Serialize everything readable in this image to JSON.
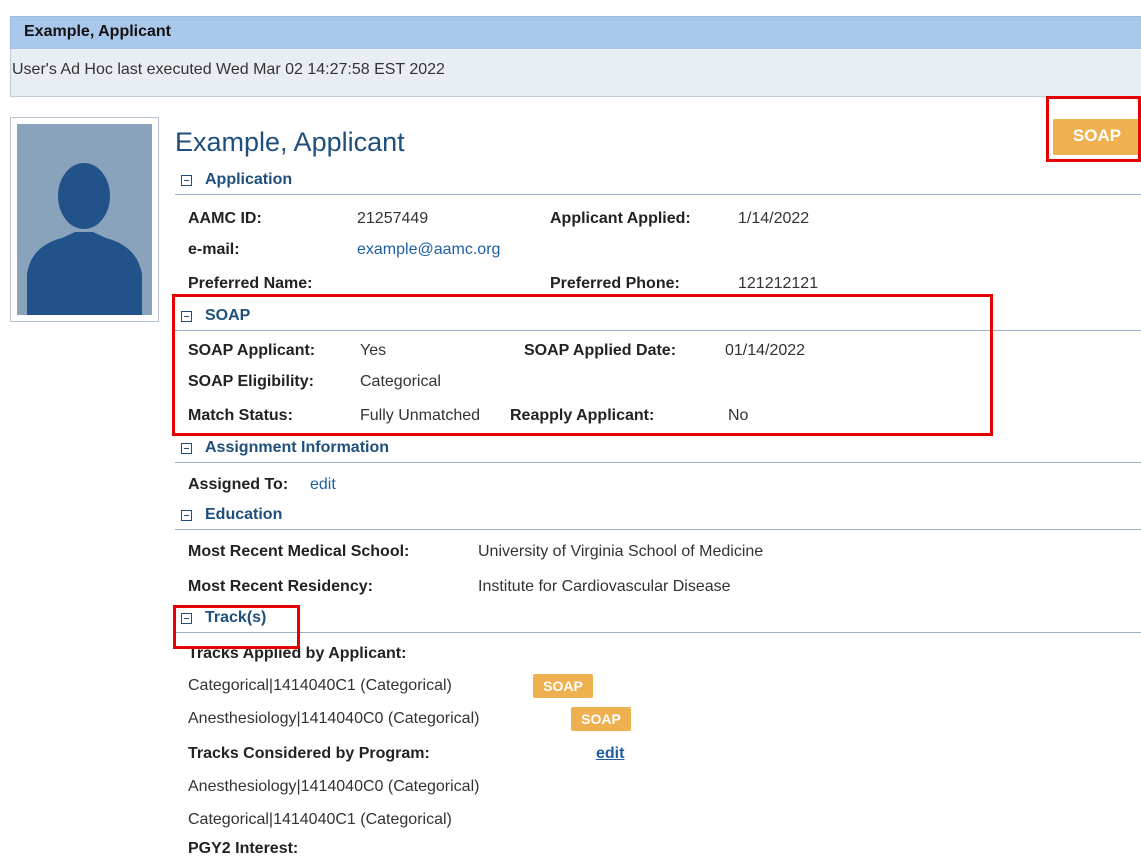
{
  "header": {
    "title": "Example, Applicant",
    "status_line": "User's Ad Hoc last executed Wed Mar 02 14:27:58 EST 2022"
  },
  "profile": {
    "name": "Example, Applicant",
    "soap_button_label": "SOAP"
  },
  "application": {
    "section_title": "Application",
    "aamc_id_label": "AAMC ID:",
    "aamc_id": "21257449",
    "applied_label": "Applicant Applied:",
    "applied_date": "1/14/2022",
    "email_label": "e-mail:",
    "email": "example@aamc.org",
    "preferred_name_label": "Preferred Name:",
    "preferred_name": "",
    "preferred_phone_label": "Preferred Phone:",
    "preferred_phone": "121212121"
  },
  "soap": {
    "section_title": "SOAP",
    "applicant_label": "SOAP Applicant:",
    "applicant": "Yes",
    "applied_date_label": "SOAP Applied Date:",
    "applied_date": "01/14/2022",
    "eligibility_label": "SOAP Eligibility:",
    "eligibility": "Categorical",
    "match_status_label": "Match Status:",
    "match_status": "Fully Unmatched",
    "reapply_label": "Reapply Applicant:",
    "reapply": "No"
  },
  "assignment": {
    "section_title": "Assignment Information",
    "assigned_to_label": "Assigned To:",
    "edit_link": "edit"
  },
  "education": {
    "section_title": "Education",
    "medical_school_label": "Most Recent Medical School:",
    "medical_school": "University of Virginia School of Medicine",
    "residency_label": "Most Recent Residency:",
    "residency": "Institute for Cardiovascular Disease"
  },
  "tracks": {
    "section_title": "Track(s)",
    "applied_label": "Tracks Applied by Applicant:",
    "applied": [
      {
        "name": "Categorical|1414040C1 (Categorical)",
        "badge": "SOAP"
      },
      {
        "name": "Anesthesiology|1414040C0 (Categorical)",
        "badge": "SOAP"
      }
    ],
    "considered_label": "Tracks Considered by Program:",
    "considered_edit": "edit",
    "considered": [
      "Anesthesiology|1414040C0 (Categorical)",
      "Categorical|1414040C1 (Categorical)"
    ],
    "pgy2_label": "PGY2 Interest:"
  },
  "colors": {
    "header_bg": "#a9c8ec",
    "title_blue": "#1f4f7c",
    "soap_orange": "#efb04f",
    "highlight_red": "#e60000"
  }
}
